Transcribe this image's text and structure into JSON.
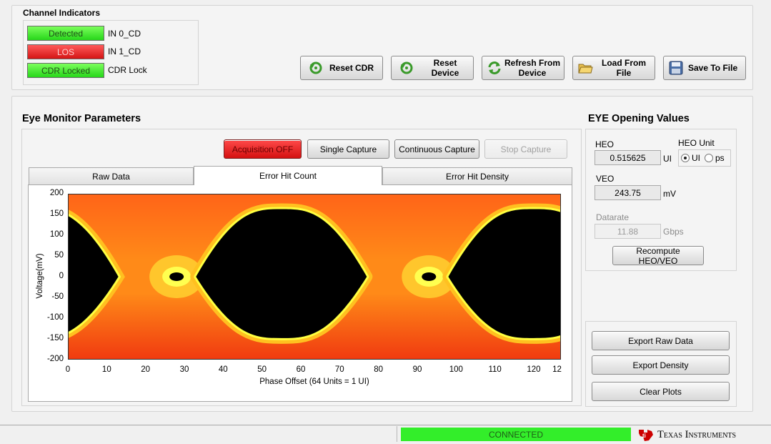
{
  "channel_indicators": {
    "title": "Channel Indicators",
    "items": [
      {
        "status": "Detected",
        "state": "green",
        "label": "IN 0_CD"
      },
      {
        "status": "LOS",
        "state": "red",
        "label": "IN 1_CD"
      },
      {
        "status": "CDR Locked",
        "state": "green",
        "label": "CDR Lock"
      }
    ]
  },
  "toolbar": {
    "reset_cdr": "Reset CDR",
    "reset_device": "Reset Device",
    "refresh_line1": "Refresh From",
    "refresh_line2": "Device",
    "load_file": "Load From File",
    "save_file": "Save To File"
  },
  "eye_monitor": {
    "title": "Eye Monitor Parameters",
    "acquisition": "Acquisition OFF",
    "single_capture": "Single Capture",
    "continuous_capture": "Continuous Capture",
    "stop_capture": "Stop Capture",
    "tabs": [
      "Raw Data",
      "Error Hit Count",
      "Error Hit Density"
    ],
    "active_tab": "Error Hit Count"
  },
  "chart_data": {
    "type": "heatmap",
    "xlabel": "Phase Offset (64 Units = 1 UI)",
    "ylabel": "Voltage(mV)",
    "xlim": [
      0,
      127
    ],
    "ylim": [
      -200,
      200
    ],
    "x_ticks": [
      "0",
      "10",
      "20",
      "30",
      "40",
      "50",
      "60",
      "70",
      "80",
      "90",
      "100",
      "110",
      "120",
      "12"
    ],
    "y_ticks": [
      "200",
      "150",
      "100",
      "50",
      "0",
      "-50",
      "-100",
      "-150",
      "-200"
    ],
    "colormap": [
      "#000000",
      "#ffff40",
      "#ffb000",
      "#ff7a10",
      "#ee2a10"
    ],
    "eye_openings": [
      {
        "x_center": 55,
        "half_width_ui_units": 22,
        "v_top": 163,
        "v_bottom": -148
      },
      {
        "x_center": 120,
        "half_width_ui_units": 22,
        "v_top": 163,
        "v_bottom": -148
      }
    ]
  },
  "eye_opening": {
    "title": "EYE Opening Values",
    "heo_label": "HEO",
    "heo_value": "0.515625",
    "heo_unit": "UI",
    "heo_unit_label": "HEO Unit",
    "unit_options": [
      "UI",
      "ps"
    ],
    "selected_unit": "UI",
    "veo_label": "VEO",
    "veo_value": "243.75",
    "veo_unit": "mV",
    "datarate_label": "Datarate",
    "datarate_value": "11.88",
    "datarate_unit": "Gbps",
    "recompute": "Recompute HEO/VEO"
  },
  "export": {
    "raw": "Export Raw Data",
    "density": "Export Density",
    "clear": "Clear Plots"
  },
  "status_bar": {
    "connection": "CONNECTED",
    "brand": "Texas Instruments"
  },
  "colors": {
    "connected": "#33ee2a",
    "indicator_green": "#27d61a",
    "indicator_red": "#d41414",
    "ti_red": "#cc0000"
  }
}
